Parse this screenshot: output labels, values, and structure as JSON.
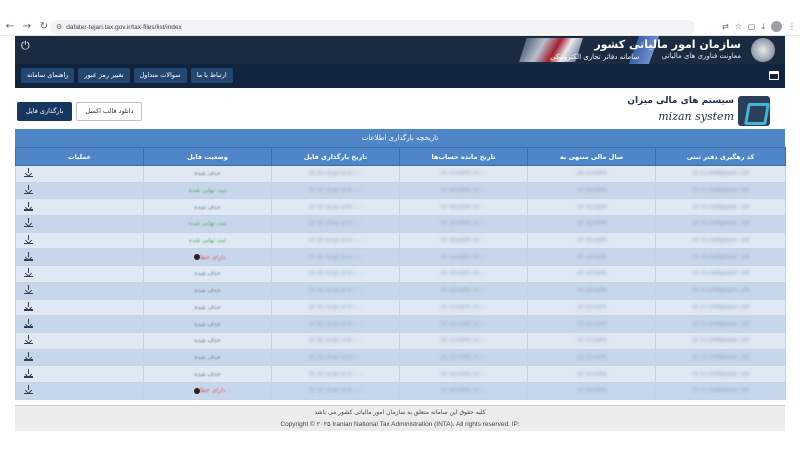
{
  "browser": {
    "url": "dafater-tejari.tax.gov.ir/tax-files/list/index"
  },
  "header": {
    "org_title": "سازمان امور مالیاتی کشور",
    "org_subtitle": "معاونت فناوری های مالیاتی",
    "system_name": "سامانه دفاتر تجاری الکترونیکی"
  },
  "nav": {
    "items": [
      "راهنمای سامانه",
      "تغییر رمز عبور",
      "سوالات متداول",
      "ارتباط با ما"
    ]
  },
  "actions": {
    "upload_label": "بارگذاری فایل",
    "download_template_label": "دانلود قالب اکسل"
  },
  "logo": {
    "fa_text": "سیستم های مالی میزان",
    "en_text": "mizan system"
  },
  "table": {
    "caption": "تاریخچه بارگذاری اطلاعات",
    "columns": [
      "کد رهگیری دفتر ثبتی",
      "سال مالی منتهی به",
      "تاریخ مانده حساب‌ها",
      "تاریخ بارگذاری فایل",
      "وضعیت فایل",
      "عملیات"
    ],
    "rows": [
      {
        "tracking": "۱۴۰۲۱۱۲۳۴۵۶۷۸۹۰۱۲۳",
        "fiscal": "۱۴۰۲/۱۲/۲۹",
        "balance": "۱۴۰۲/۱۲/۲۹ ۱۲:۰۰",
        "upload": "۱۴۰۳/۰۲/۱۵ ۱۲:۳۰:۰۰",
        "status": "حذف شده",
        "status_type": "deleted"
      },
      {
        "tracking": "۱۴۰۲۱۱۲۳۴۵۶۷۸۹۰۱۲۳",
        "fiscal": "۱۴۰۲/۱۲/۲۹",
        "balance": "۱۴۰۲/۱۲/۲۹ ۱۲:۰۰",
        "upload": "۱۴۰۳/۰۲/۱۵ ۱۲:۳۰:۰۰",
        "status": "ثبت نهایی شده",
        "status_type": "final"
      },
      {
        "tracking": "۱۴۰۲۱۱۲۳۴۵۶۷۸۹۰۱۲۳",
        "fiscal": "۱۴۰۲/۱۲/۲۹",
        "balance": "۱۴۰۲/۱۲/۲۹ ۱۲:۰۰",
        "upload": "۱۴۰۳/۰۲/۱۵ ۱۲:۳۰:۰۰",
        "status": "حذف شده",
        "status_type": "deleted"
      },
      {
        "tracking": "۱۴۰۲۱۱۲۳۴۵۶۷۸۹۰۱۲۳",
        "fiscal": "۱۴۰۲/۱۲/۲۹",
        "balance": "۱۴۰۲/۱۲/۲۹ ۱۲:۰۰",
        "upload": "۱۴۰۳/۰۲/۱۵ ۱۲:۳۰:۰۰",
        "status": "ثبت نهایی شده",
        "status_type": "final"
      },
      {
        "tracking": "۱۴۰۲۱۱۲۳۴۵۶۷۸۹۰۱۲۳",
        "fiscal": "۱۴۰۲/۱۲/۲۹",
        "balance": "۱۴۰۲/۱۲/۲۹ ۱۲:۰۰",
        "upload": "۱۴۰۳/۰۲/۱۵ ۱۲:۳۰:۰۰",
        "status": "ثبت نهایی شده",
        "status_type": "final"
      },
      {
        "tracking": "۱۴۰۲۱۱۲۳۴۵۶۷۸۹۰۱۲۳",
        "fiscal": "۱۴۰۲/۱۲/۲۹",
        "balance": "۱۴۰۲/۱۲/۲۹ ۱۲:۰۰",
        "upload": "۱۴۰۳/۰۲/۱۵ ۱۲:۳۰:۰۰",
        "status": "دارای خطا",
        "status_type": "error"
      },
      {
        "tracking": "۱۴۰۲۱۱۲۳۴۵۶۷۸۹۰۱۲۳",
        "fiscal": "۱۴۰۲/۱۲/۲۹",
        "balance": "۱۴۰۲/۱۲/۲۹ ۱۲:۰۰",
        "upload": "۱۴۰۳/۰۲/۱۵ ۱۲:۳۰:۰۰",
        "status": "حذف شده",
        "status_type": "deleted"
      },
      {
        "tracking": "۱۴۰۲۱۱۲۳۴۵۶۷۸۹۰۱۲۳",
        "fiscal": "۱۴۰۲/۱۲/۲۹",
        "balance": "۱۴۰۲/۱۲/۲۹ ۱۲:۰۰",
        "upload": "۱۴۰۳/۰۲/۱۵ ۱۲:۳۰:۰۰",
        "status": "حذف شده",
        "status_type": "deleted"
      },
      {
        "tracking": "۱۴۰۲۱۱۲۳۴۵۶۷۸۹۰۱۲۳",
        "fiscal": "۱۴۰۲/۱۲/۲۹",
        "balance": "۱۴۰۲/۱۲/۲۹ ۱۲:۰۰",
        "upload": "۱۴۰۳/۰۲/۱۵ ۱۲:۳۰:۰۰",
        "status": "حذف شده",
        "status_type": "deleted"
      },
      {
        "tracking": "۱۴۰۲۱۱۲۳۴۵۶۷۸۹۰۱۲۳",
        "fiscal": "۱۴۰۲/۱۲/۲۹",
        "balance": "۱۴۰۲/۱۲/۲۹ ۱۲:۰۰",
        "upload": "۱۴۰۳/۰۲/۱۵ ۱۲:۳۰:۰۰",
        "status": "حذف شده",
        "status_type": "deleted"
      },
      {
        "tracking": "۱۴۰۲۱۱۲۳۴۵۶۷۸۹۰۱۲۳",
        "fiscal": "۱۴۰۲/۱۲/۲۹",
        "balance": "۱۴۰۲/۱۲/۲۹ ۱۲:۰۰",
        "upload": "۱۴۰۳/۰۲/۱۵ ۱۲:۳۰:۰۰",
        "status": "حذف شده",
        "status_type": "deleted"
      },
      {
        "tracking": "۱۴۰۲۱۱۲۳۴۵۶۷۸۹۰۱۲۳",
        "fiscal": "۱۴۰۲/۱۲/۲۹",
        "balance": "۱۴۰۲/۱۲/۲۹ ۱۲:۰۰",
        "upload": "۱۴۰۳/۰۲/۱۵ ۱۲:۳۰:۰۰",
        "status": "حذف شده",
        "status_type": "deleted"
      },
      {
        "tracking": "۱۴۰۲۱۱۲۳۴۵۶۷۸۹۰۱۲۳",
        "fiscal": "۱۴۰۲/۱۲/۲۹",
        "balance": "۱۴۰۲/۱۲/۲۹ ۱۲:۰۰",
        "upload": "۱۴۰۳/۰۲/۱۵ ۱۲:۳۰:۰۰",
        "status": "حذف شده",
        "status_type": "deleted"
      },
      {
        "tracking": "۱۴۰۲۱۱۲۳۴۵۶۷۸۹۰۱۲۳",
        "fiscal": "۱۴۰۲/۱۲/۲۹",
        "balance": "۱۴۰۲/۱۲/۲۹ ۱۲:۰۰",
        "upload": "۱۴۰۳/۰۲/۱۵ ۱۲:۳۰:۰۰",
        "status": "دارای خطا",
        "status_type": "error"
      }
    ]
  },
  "footer": {
    "fa_text": "کلیه حقوق این سامانه متعلق به سازمان امور مالیاتی کشور می باشد",
    "en_text": "Copyright © ۲۰۲۵ Iranian National Tax Administration (INTA). All rights reserved. IP:"
  },
  "colors": {
    "header_bg": "#1a2a3f",
    "nav_bg": "#10233f",
    "table_head": "#4f86c8",
    "row_light": "#dfe8f3",
    "row_dark": "#c7d7eb",
    "status_final": "#4ea85b",
    "status_error": "#e04b4b"
  },
  "icons": {
    "power": "power-icon",
    "download": "download-icon",
    "menu": "grid-menu-icon"
  }
}
